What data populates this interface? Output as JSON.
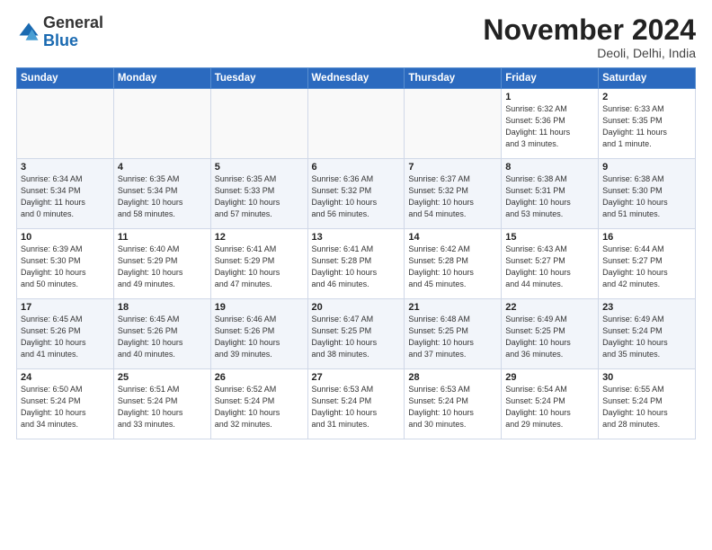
{
  "logo": {
    "general": "General",
    "blue": "Blue"
  },
  "title": "November 2024",
  "location": "Deoli, Delhi, India",
  "weekdays": [
    "Sunday",
    "Monday",
    "Tuesday",
    "Wednesday",
    "Thursday",
    "Friday",
    "Saturday"
  ],
  "weeks": [
    [
      {
        "day": "",
        "info": ""
      },
      {
        "day": "",
        "info": ""
      },
      {
        "day": "",
        "info": ""
      },
      {
        "day": "",
        "info": ""
      },
      {
        "day": "",
        "info": ""
      },
      {
        "day": "1",
        "info": "Sunrise: 6:32 AM\nSunset: 5:36 PM\nDaylight: 11 hours\nand 3 minutes."
      },
      {
        "day": "2",
        "info": "Sunrise: 6:33 AM\nSunset: 5:35 PM\nDaylight: 11 hours\nand 1 minute."
      }
    ],
    [
      {
        "day": "3",
        "info": "Sunrise: 6:34 AM\nSunset: 5:34 PM\nDaylight: 11 hours\nand 0 minutes."
      },
      {
        "day": "4",
        "info": "Sunrise: 6:35 AM\nSunset: 5:34 PM\nDaylight: 10 hours\nand 58 minutes."
      },
      {
        "day": "5",
        "info": "Sunrise: 6:35 AM\nSunset: 5:33 PM\nDaylight: 10 hours\nand 57 minutes."
      },
      {
        "day": "6",
        "info": "Sunrise: 6:36 AM\nSunset: 5:32 PM\nDaylight: 10 hours\nand 56 minutes."
      },
      {
        "day": "7",
        "info": "Sunrise: 6:37 AM\nSunset: 5:32 PM\nDaylight: 10 hours\nand 54 minutes."
      },
      {
        "day": "8",
        "info": "Sunrise: 6:38 AM\nSunset: 5:31 PM\nDaylight: 10 hours\nand 53 minutes."
      },
      {
        "day": "9",
        "info": "Sunrise: 6:38 AM\nSunset: 5:30 PM\nDaylight: 10 hours\nand 51 minutes."
      }
    ],
    [
      {
        "day": "10",
        "info": "Sunrise: 6:39 AM\nSunset: 5:30 PM\nDaylight: 10 hours\nand 50 minutes."
      },
      {
        "day": "11",
        "info": "Sunrise: 6:40 AM\nSunset: 5:29 PM\nDaylight: 10 hours\nand 49 minutes."
      },
      {
        "day": "12",
        "info": "Sunrise: 6:41 AM\nSunset: 5:29 PM\nDaylight: 10 hours\nand 47 minutes."
      },
      {
        "day": "13",
        "info": "Sunrise: 6:41 AM\nSunset: 5:28 PM\nDaylight: 10 hours\nand 46 minutes."
      },
      {
        "day": "14",
        "info": "Sunrise: 6:42 AM\nSunset: 5:28 PM\nDaylight: 10 hours\nand 45 minutes."
      },
      {
        "day": "15",
        "info": "Sunrise: 6:43 AM\nSunset: 5:27 PM\nDaylight: 10 hours\nand 44 minutes."
      },
      {
        "day": "16",
        "info": "Sunrise: 6:44 AM\nSunset: 5:27 PM\nDaylight: 10 hours\nand 42 minutes."
      }
    ],
    [
      {
        "day": "17",
        "info": "Sunrise: 6:45 AM\nSunset: 5:26 PM\nDaylight: 10 hours\nand 41 minutes."
      },
      {
        "day": "18",
        "info": "Sunrise: 6:45 AM\nSunset: 5:26 PM\nDaylight: 10 hours\nand 40 minutes."
      },
      {
        "day": "19",
        "info": "Sunrise: 6:46 AM\nSunset: 5:26 PM\nDaylight: 10 hours\nand 39 minutes."
      },
      {
        "day": "20",
        "info": "Sunrise: 6:47 AM\nSunset: 5:25 PM\nDaylight: 10 hours\nand 38 minutes."
      },
      {
        "day": "21",
        "info": "Sunrise: 6:48 AM\nSunset: 5:25 PM\nDaylight: 10 hours\nand 37 minutes."
      },
      {
        "day": "22",
        "info": "Sunrise: 6:49 AM\nSunset: 5:25 PM\nDaylight: 10 hours\nand 36 minutes."
      },
      {
        "day": "23",
        "info": "Sunrise: 6:49 AM\nSunset: 5:24 PM\nDaylight: 10 hours\nand 35 minutes."
      }
    ],
    [
      {
        "day": "24",
        "info": "Sunrise: 6:50 AM\nSunset: 5:24 PM\nDaylight: 10 hours\nand 34 minutes."
      },
      {
        "day": "25",
        "info": "Sunrise: 6:51 AM\nSunset: 5:24 PM\nDaylight: 10 hours\nand 33 minutes."
      },
      {
        "day": "26",
        "info": "Sunrise: 6:52 AM\nSunset: 5:24 PM\nDaylight: 10 hours\nand 32 minutes."
      },
      {
        "day": "27",
        "info": "Sunrise: 6:53 AM\nSunset: 5:24 PM\nDaylight: 10 hours\nand 31 minutes."
      },
      {
        "day": "28",
        "info": "Sunrise: 6:53 AM\nSunset: 5:24 PM\nDaylight: 10 hours\nand 30 minutes."
      },
      {
        "day": "29",
        "info": "Sunrise: 6:54 AM\nSunset: 5:24 PM\nDaylight: 10 hours\nand 29 minutes."
      },
      {
        "day": "30",
        "info": "Sunrise: 6:55 AM\nSunset: 5:24 PM\nDaylight: 10 hours\nand 28 minutes."
      }
    ]
  ]
}
